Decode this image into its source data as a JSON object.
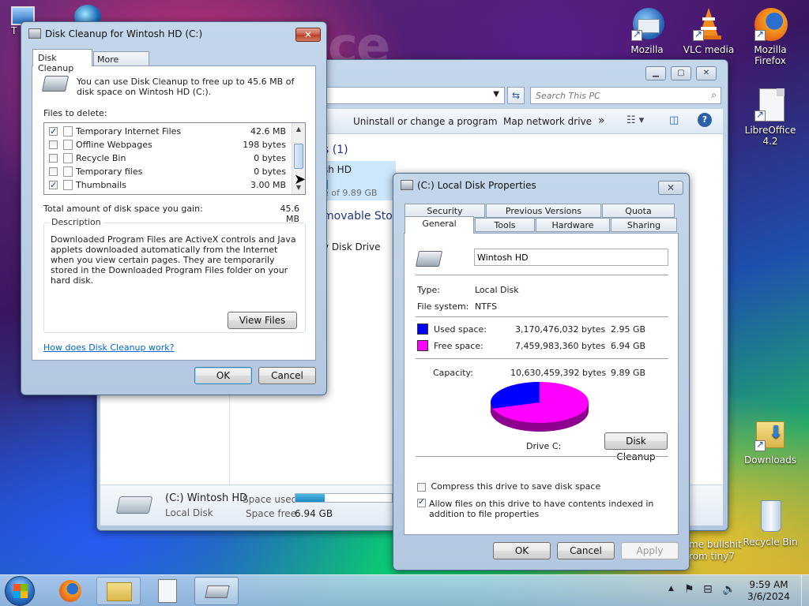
{
  "desktop": {
    "left_icons": [
      {
        "name": "T",
        "label": "T"
      }
    ],
    "right_icons": [
      {
        "label": "Mozilla"
      },
      {
        "label": "VLC media"
      },
      {
        "label": "Mozilla Firefox"
      },
      {
        "label": "LibreOffice 4.2"
      },
      {
        "label": "Downloads"
      },
      {
        "label": "Recycle Bin"
      }
    ],
    "partial_label_1": "me bullshit",
    "partial_label_2": "rom tiny7",
    "wallpaper_text": "ence"
  },
  "explorer": {
    "search_placeholder": "Search This PC",
    "toolbar": {
      "uninstall": "Uninstall or change a program",
      "map_drive": "Map network drive",
      "more": "»"
    },
    "section_heading": "s (1)",
    "drive_name": "sh HD",
    "drive_free": "e of 9.89 GB",
    "removable": "movable Sto",
    "dvd_drive": "y Disk Drive",
    "details": {
      "title": "(C:) Wintosh HD",
      "subtitle": "Local Disk",
      "space_used_label": "Space used:",
      "space_free_label": "Space free:",
      "space_free_value": "6.94 GB",
      "used_fraction": 0.3
    }
  },
  "cleanup": {
    "title": "Disk Cleanup for Wintosh HD (C:)",
    "tabs": [
      "Disk Cleanup",
      "More Options"
    ],
    "intro": "You can use Disk Cleanup to free up to 45.6 MB of disk space on Wintosh HD (C:).",
    "files_to_delete_label": "Files to delete:",
    "files": [
      {
        "name": "Temporary Internet Files",
        "size": "42.6 MB",
        "checked": true
      },
      {
        "name": "Offline Webpages",
        "size": "198 bytes",
        "checked": false
      },
      {
        "name": "Recycle Bin",
        "size": "0 bytes",
        "checked": false
      },
      {
        "name": "Temporary files",
        "size": "0 bytes",
        "checked": false
      },
      {
        "name": "Thumbnails",
        "size": "3.00 MB",
        "checked": true
      }
    ],
    "total_label": "Total amount of disk space you gain:",
    "total_value": "45.6 MB",
    "description_label": "Description",
    "description_text": "Downloaded Program Files are ActiveX controls and Java applets downloaded automatically from the Internet when you view certain pages. They are temporarily stored in the Downloaded Program Files folder on your hard disk.",
    "view_files": "View Files",
    "help_link": "How does Disk Cleanup work?",
    "ok": "OK",
    "cancel": "Cancel"
  },
  "properties": {
    "title": "(C:) Local Disk Properties",
    "tabs_row1": [
      "Security",
      "Previous Versions",
      "Quota"
    ],
    "tabs_row2": [
      "General",
      "Tools",
      "Hardware",
      "Sharing"
    ],
    "volume_label": "Wintosh HD",
    "type_label": "Type:",
    "type_value": "Local Disk",
    "fs_label": "File system:",
    "fs_value": "NTFS",
    "used_label": "Used space:",
    "used_bytes": "3,170,476,032 bytes",
    "used_gb": "2.95 GB",
    "free_label": "Free space:",
    "free_bytes": "7,459,983,360 bytes",
    "free_gb": "6.94 GB",
    "capacity_label": "Capacity:",
    "capacity_bytes": "10,630,459,392 bytes",
    "capacity_gb": "9.89 GB",
    "drive_label": "Drive C:",
    "disk_cleanup_btn": "Disk Cleanup",
    "compress_label": "Compress this drive to save disk space",
    "index_label": "Allow files on this drive to have contents indexed in addition to file properties",
    "compress_checked": false,
    "index_checked": true,
    "ok": "OK",
    "cancel": "Cancel",
    "apply": "Apply",
    "used_color": "#0000ff",
    "free_color": "#ff00ff"
  },
  "taskbar": {
    "time": "9:59 AM",
    "date": "3/6/2024"
  }
}
